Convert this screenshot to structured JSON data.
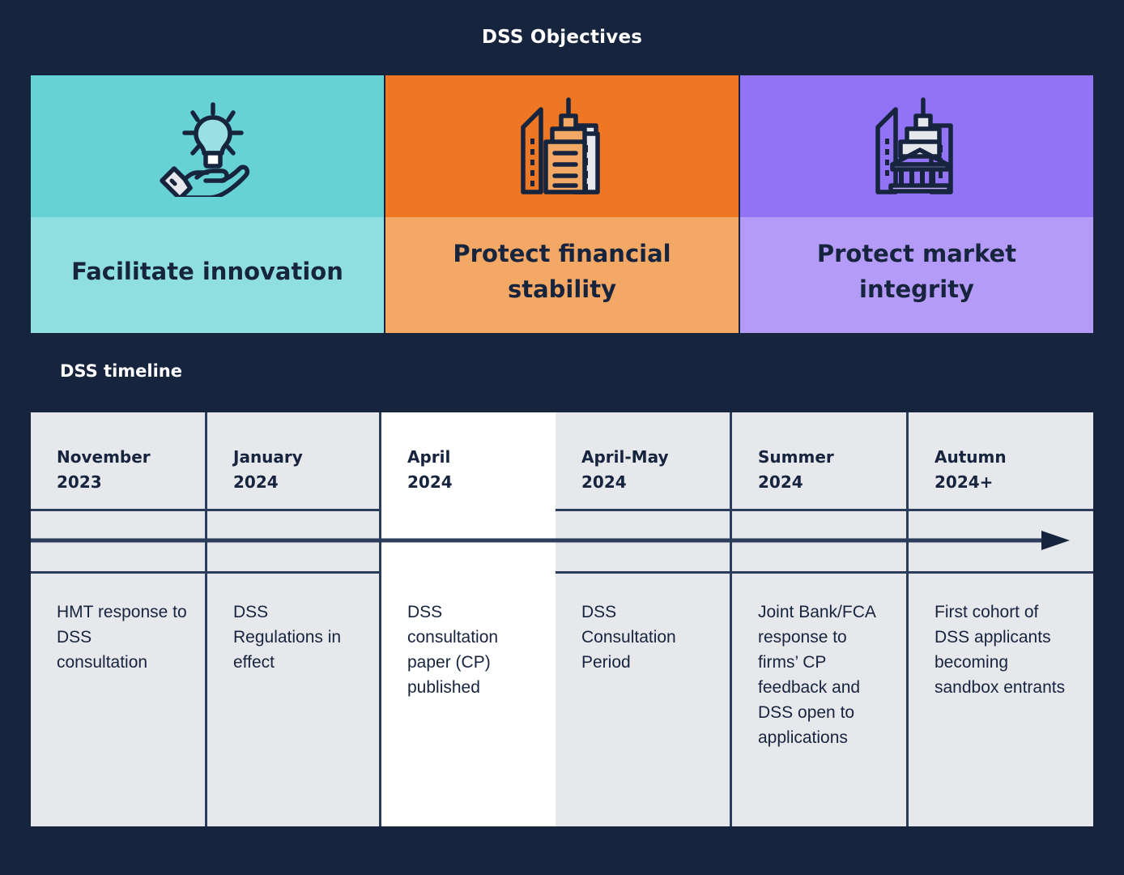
{
  "header": {
    "title": "DSS Objectives"
  },
  "objectives": {
    "cards": [
      {
        "label_lines": [
          "Facilitate innovation"
        ],
        "icon": "hand-lightbulb-icon",
        "icon_color": "#66d2d6",
        "label_color": "#8fdee0"
      },
      {
        "label_lines": [
          "Protect financial",
          "stability"
        ],
        "icon": "city-buildings-icon",
        "icon_color": "#ef7622",
        "label_color": "#f4a866"
      },
      {
        "label_lines": [
          "Protect market",
          "integrity"
        ],
        "icon": "bank-building-icon",
        "icon_color": "#9272f5",
        "label_color": "#b49bf7"
      }
    ]
  },
  "timeline": {
    "heading": "DSS timeline",
    "arrow_icon": "right-arrow-icon",
    "columns": [
      {
        "period": "November",
        "year": "2023",
        "description": "HMT response to DSS consultation",
        "highlighted": false
      },
      {
        "period": "January",
        "year": "2024",
        "description": "DSS Regulations in effect",
        "highlighted": false
      },
      {
        "period": "April",
        "year": "2024",
        "description": "DSS consultation paper (CP) published",
        "highlighted": true
      },
      {
        "period": "April-May",
        "year": "2024",
        "description": "DSS Consultation Period",
        "highlighted": false
      },
      {
        "period": "Summer",
        "year": "2024",
        "description": "Joint Bank/FCA response to firms’ CP feedback and DSS open to applications",
        "highlighted": false
      },
      {
        "period": "Autumn",
        "year": "2024+",
        "description": "First cohort of DSS applicants becoming sandbox entrants",
        "highlighted": false
      }
    ]
  },
  "colors": {
    "background": "#17243e",
    "cell_background": "#e6e8ec",
    "cell_highlight": "#ffffff",
    "line": "#2c3d5c",
    "text_dark": "#17243e",
    "text_light": "#ffffff"
  }
}
